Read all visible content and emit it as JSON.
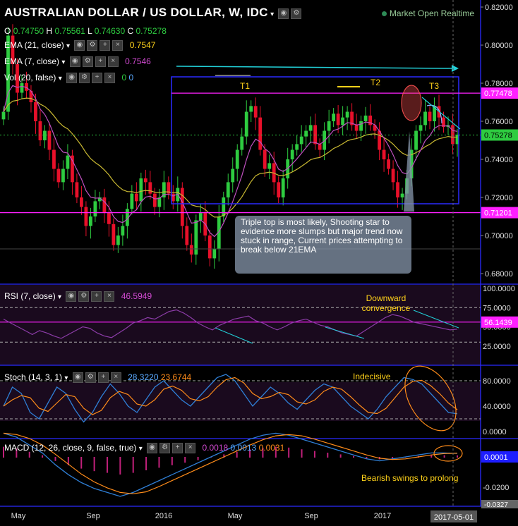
{
  "header": {
    "symbol_title": "AUSTRALIAN DOLLAR / US DOLLAR, W, IDC",
    "ohlc": {
      "o_label": "O",
      "o": "0.74750",
      "h_label": "H",
      "h": "0.75561",
      "l_label": "L",
      "l": "0.74630",
      "c_label": "C",
      "c": "0.75278"
    },
    "market_status": "Market Open",
    "realtime": "Realtime"
  },
  "indicators": {
    "ema21": {
      "label": "EMA (21, close)",
      "value": "0.7547"
    },
    "ema7": {
      "label": "EMA (7, close)",
      "value": "0.7546"
    },
    "vol": {
      "label": "Vol (20, false)",
      "v1": "0",
      "v2": "0"
    },
    "rsi": {
      "label": "RSI (7, close)",
      "value": "46.5949"
    },
    "stoch": {
      "label": "Stoch (14, 3, 1)",
      "k": "28.3220",
      "d": "23.6744"
    },
    "macd": {
      "label": "MACD (12, 26, close, 9, false, true)",
      "v1": "0.0018",
      "v2": "0.0013",
      "v3": "0.0031"
    }
  },
  "annotations": {
    "t1": "T1",
    "t2": "T2",
    "t3": "T3",
    "callout": "Triple top is most likely, Shooting star to evidence more slumps but major trend now stuck in range, Current prices attempting to break below 21EMA",
    "rsi_note_1": "Downward",
    "rsi_note_2": "convergence",
    "stoch_note": "Indecisive",
    "macd_note": "Bearish swings to prolong"
  },
  "price_axis": {
    "ticks": [
      "0.82000",
      "0.80000",
      "0.78000",
      "0.76000",
      "0.74000",
      "0.72000",
      "0.70000",
      "0.68000"
    ],
    "tags": {
      "upper": "0.77478",
      "last": "0.75278",
      "lower": "0.71201"
    }
  },
  "rsi_axis": {
    "ticks": [
      "100.0000",
      "75.0000",
      "50.0000",
      "25.0000"
    ],
    "tag": "56.1439"
  },
  "stoch_axis": {
    "ticks": [
      "80.0000",
      "40.0000",
      "0.0000"
    ]
  },
  "macd_axis": {
    "ticks": [
      "-0.0200"
    ],
    "tag_top": "0.0001",
    "tag_bottom": "-0.0327"
  },
  "time_axis": {
    "ticks": [
      "May",
      "Sep",
      "2016",
      "May",
      "Sep",
      "2017"
    ],
    "cursor": "2017-05-01"
  },
  "colors": {
    "bull": "#2ecc40",
    "bear": "#e8102a",
    "ema21": "#c8b832",
    "ema7": "#c050c0",
    "box": "#2a2aff",
    "magenta": "#ff20ff",
    "cyan": "#22d0d8",
    "rsi": "#8c3ca8",
    "stoch_k": "#2f7fd6",
    "stoch_d": "#ff8c1a",
    "macd": "#2f7fd6",
    "signal": "#ff8c1a",
    "hist": "#c0207a"
  },
  "chart_data": {
    "type": "candlestick",
    "timeframe": "W",
    "symbol": "AUDUSD",
    "y_axis_range": [
      0.68,
      0.82
    ],
    "horizontal_levels": {
      "resistance": 0.77478,
      "support": 0.71201,
      "last": 0.75278
    },
    "weekly_close_approx": [
      0.765,
      0.805,
      0.79,
      0.775,
      0.78,
      0.776,
      0.77,
      0.76,
      0.75,
      0.755,
      0.745,
      0.735,
      0.728,
      0.735,
      0.742,
      0.728,
      0.72,
      0.715,
      0.705,
      0.71,
      0.718,
      0.72,
      0.712,
      0.706,
      0.695,
      0.7,
      0.705,
      0.714,
      0.722,
      0.718,
      0.73,
      0.728,
      0.722,
      0.715,
      0.72,
      0.728,
      0.722,
      0.718,
      0.725,
      0.705,
      0.695,
      0.69,
      0.708,
      0.712,
      0.7,
      0.688,
      0.693,
      0.71,
      0.72,
      0.728,
      0.735,
      0.745,
      0.752,
      0.765,
      0.768,
      0.762,
      0.745,
      0.735,
      0.738,
      0.728,
      0.72,
      0.73,
      0.74,
      0.745,
      0.748,
      0.752,
      0.755,
      0.758,
      0.748,
      0.745,
      0.755,
      0.76,
      0.764,
      0.758,
      0.762,
      0.765,
      0.758,
      0.755,
      0.76,
      0.763,
      0.758,
      0.755,
      0.745,
      0.74,
      0.735,
      0.728,
      0.72,
      0.722,
      0.73,
      0.745,
      0.755,
      0.758,
      0.765,
      0.76,
      0.768,
      0.762,
      0.757,
      0.758,
      0.748,
      0.753
    ],
    "rsi_approx": [
      60,
      55,
      50,
      45,
      40,
      45,
      42,
      38,
      35,
      40,
      45,
      50,
      48,
      42,
      38,
      36,
      42,
      48,
      55,
      58,
      62,
      60,
      65,
      70,
      72,
      68,
      62,
      55,
      50,
      46,
      52,
      56,
      60,
      62,
      64,
      58,
      55,
      50,
      46,
      50,
      55,
      58,
      60,
      56,
      52,
      50,
      46,
      42,
      40,
      38,
      44,
      50,
      56,
      62,
      66,
      64,
      60,
      56,
      54,
      52,
      50,
      48,
      46,
      47
    ],
    "stoch_k_approx": [
      40,
      70,
      60,
      30,
      20,
      45,
      70,
      60,
      35,
      15,
      30,
      55,
      75,
      60,
      40,
      30,
      50,
      70,
      80,
      65,
      50,
      40,
      55,
      70,
      85,
      90,
      80,
      60,
      40,
      55,
      70,
      60,
      45,
      35,
      50,
      65,
      75,
      70,
      55,
      40,
      30,
      20,
      35,
      55,
      70,
      85,
      82,
      75,
      60,
      45,
      30,
      28
    ],
    "macd_approx": [
      0.012,
      0.01,
      0.006,
      0.002,
      -0.004,
      -0.009,
      -0.013,
      -0.016,
      -0.018,
      -0.02,
      -0.018,
      -0.015,
      -0.012,
      -0.009,
      -0.006,
      -0.003,
      0.0,
      0.003,
      0.006,
      0.009,
      0.011,
      0.012,
      0.011,
      0.009,
      0.007,
      0.005,
      0.003,
      0.001,
      -0.001,
      -0.002,
      -0.001,
      0.0,
      0.001,
      0.002,
      0.002,
      0.0018
    ]
  }
}
